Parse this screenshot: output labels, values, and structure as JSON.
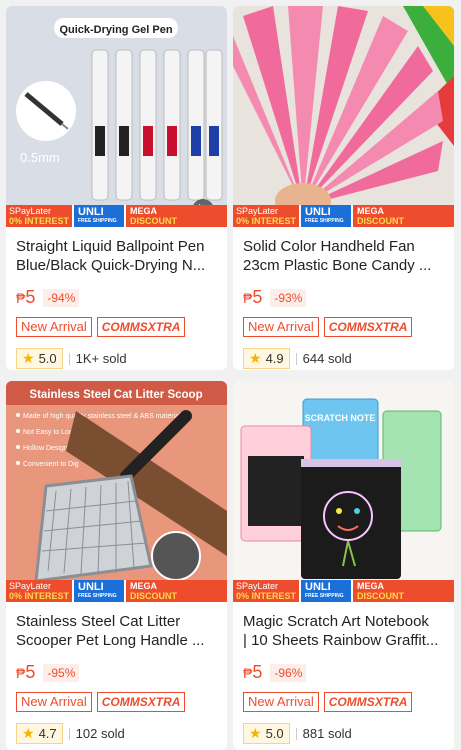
{
  "strip": {
    "spay": "SPayLater",
    "interest": "0% INTEREST",
    "unli": "UNLI",
    "free_shipping": "FREE SHIPPING",
    "mega": "MEGA",
    "discount": "DISCOUNT"
  },
  "products": [
    {
      "image_text": "Quick-Drying Gel Pen",
      "image_subtext": "0.5mm",
      "title_line1": "Straight Liquid Ballpoint Pen",
      "title_line2": "Blue/Black Quick-Drying N...",
      "currency": "₱",
      "price": "5",
      "discount": "-94%",
      "tag_new": "New Arrival",
      "tag_commsxtra": "COMMSXTRA",
      "rating": "5.0",
      "sold": "1K+ sold"
    },
    {
      "title_line1": "Solid Color Handheld Fan",
      "title_line2": "23cm Plastic Bone Candy ...",
      "currency": "₱",
      "price": "5",
      "discount": "-93%",
      "tag_new": "New Arrival",
      "tag_commsxtra": "COMMSXTRA",
      "rating": "4.9",
      "sold": "644 sold"
    },
    {
      "image_text": "Stainless Steel Cat Litter Scoop",
      "image_bullets": [
        "Made of high quality stainless steel & ABS material",
        "Not Easy to Loosen",
        "Hollow Design",
        "Convenient to Dig"
      ],
      "title_line1": "Stainless Steel Cat Litter",
      "title_line2": "Scooper Pet Long Handle ...",
      "currency": "₱",
      "price": "5",
      "discount": "-95%",
      "tag_new": "New Arrival",
      "tag_commsxtra": "COMMSXTRA",
      "rating": "4.7",
      "sold": "102 sold"
    },
    {
      "image_text": "SCRATCH NOTE",
      "title_line1": "Magic Scratch Art Notebook",
      "title_line2": "| 10 Sheets Rainbow Graffit...",
      "currency": "₱",
      "price": "5",
      "discount": "-96%",
      "tag_new": "New Arrival",
      "tag_commsxtra": "COMMSXTRA",
      "rating": "5.0",
      "sold": "881 sold"
    }
  ]
}
